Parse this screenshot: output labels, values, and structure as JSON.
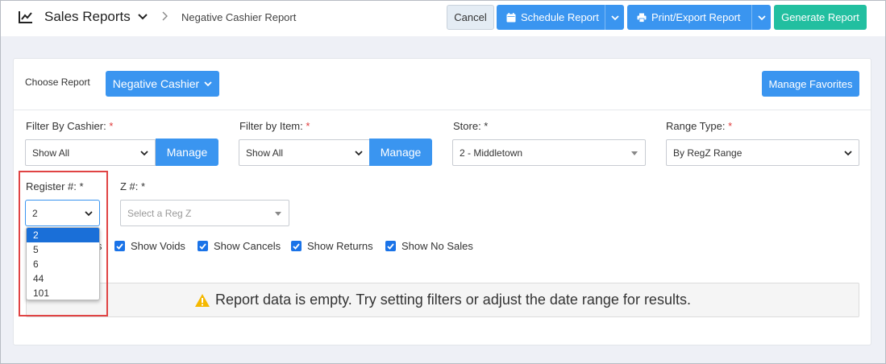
{
  "header": {
    "title": "Sales Reports",
    "breadcrumb": "Negative Cashier Report",
    "icon": "chart-line-icon"
  },
  "toolbar": {
    "cancel_label": "Cancel",
    "schedule_label": "Schedule Report",
    "print_label": "Print/Export Report",
    "generate_label": "Generate Report"
  },
  "report": {
    "choose_label": "Choose Report",
    "selected": "Negative Cashier",
    "manage_favorites_label": "Manage Favorites"
  },
  "filters": {
    "cashier": {
      "label": "Filter By Cashier:",
      "value": "Show All",
      "manage_label": "Manage"
    },
    "item": {
      "label": "Filter by Item:",
      "value": "Show All",
      "manage_label": "Manage"
    },
    "store": {
      "label": "Store: *",
      "value": "2 - Middletown"
    },
    "range": {
      "label": "Range Type:",
      "value": "By RegZ Range"
    },
    "register": {
      "label": "Register #: *",
      "value": "2",
      "options": [
        "2",
        "5",
        "6",
        "44",
        "101"
      ]
    },
    "z": {
      "label": "Z #: *",
      "placeholder": "Select a Reg Z"
    },
    "required_mark": "*"
  },
  "checkboxes": {
    "partial": "s",
    "voids": "Show Voids",
    "cancels": "Show Cancels",
    "returns": "Show Returns",
    "no_sales": "Show No Sales"
  },
  "empty_message": "Report data is empty. Try setting filters or adjust the date range for results.",
  "colors": {
    "primary": "#3a95f0",
    "success": "#22bfa0",
    "required": "#e03a3a",
    "highlight": "#e04444"
  }
}
